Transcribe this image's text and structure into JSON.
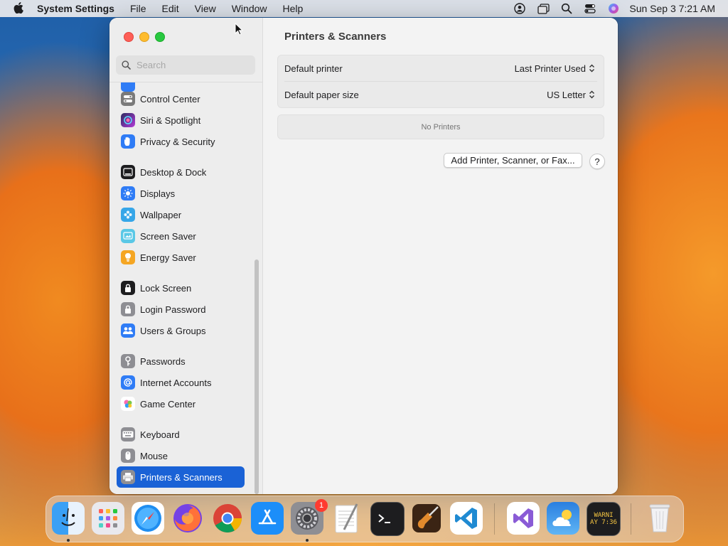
{
  "menubar": {
    "app_name": "System Settings",
    "menus": [
      "File",
      "Edit",
      "View",
      "Window",
      "Help"
    ],
    "clock": "Sun Sep 3  7:21 AM"
  },
  "sidebar": {
    "search_placeholder": "Search",
    "items": [
      {
        "label": "Control Center",
        "icon": "control-center-icon",
        "color": "#7a7a7a"
      },
      {
        "label": "Siri & Spotlight",
        "icon": "siri-icon",
        "color": "#b33bd8"
      },
      {
        "label": "Privacy & Security",
        "icon": "hand-icon",
        "color": "#2f7cf6"
      },
      {
        "label": "Desktop & Dock",
        "icon": "desktop-dock-icon",
        "color": "#1d1d1f"
      },
      {
        "label": "Displays",
        "icon": "sun-icon",
        "color": "#2f7cf6"
      },
      {
        "label": "Wallpaper",
        "icon": "wallpaper-icon",
        "color": "#36a6e8"
      },
      {
        "label": "Screen Saver",
        "icon": "screen-saver-icon",
        "color": "#5ac8e6"
      },
      {
        "label": "Energy Saver",
        "icon": "lightbulb-icon",
        "color": "#f5a623"
      },
      {
        "label": "Lock Screen",
        "icon": "lock-icon",
        "color": "#1d1d1f"
      },
      {
        "label": "Login Password",
        "icon": "lock-icon",
        "color": "#8e8e93"
      },
      {
        "label": "Users & Groups",
        "icon": "users-icon",
        "color": "#2f7cf6"
      },
      {
        "label": "Passwords",
        "icon": "key-icon",
        "color": "#8e8e93"
      },
      {
        "label": "Internet Accounts",
        "icon": "at-icon",
        "color": "#2f7cf6"
      },
      {
        "label": "Game Center",
        "icon": "game-center-icon",
        "color": "#ffffff"
      },
      {
        "label": "Keyboard",
        "icon": "keyboard-icon",
        "color": "#8e8e93"
      },
      {
        "label": "Mouse",
        "icon": "mouse-icon",
        "color": "#8e8e93"
      },
      {
        "label": "Printers & Scanners",
        "icon": "printer-icon",
        "color": "#8e8e93"
      }
    ]
  },
  "main": {
    "title": "Printers & Scanners",
    "default_printer_label": "Default printer",
    "default_printer_value": "Last Printer Used",
    "default_paper_label": "Default paper size",
    "default_paper_value": "US Letter",
    "empty_text": "No Printers",
    "add_button": "Add Printer, Scanner, or Fax...",
    "help_button": "?"
  },
  "dock": {
    "apps": [
      "Finder",
      "Launchpad",
      "Safari",
      "Firefox",
      "Chrome",
      "App Store",
      "System Settings",
      "TextEdit",
      "Terminal",
      "GarageBand",
      "VS Code",
      "Visual Studio",
      "Weather",
      "Console",
      "Trash"
    ],
    "settings_badge": "1",
    "console_text_1": "WARNI",
    "console_text_2": "AY 7:36"
  }
}
